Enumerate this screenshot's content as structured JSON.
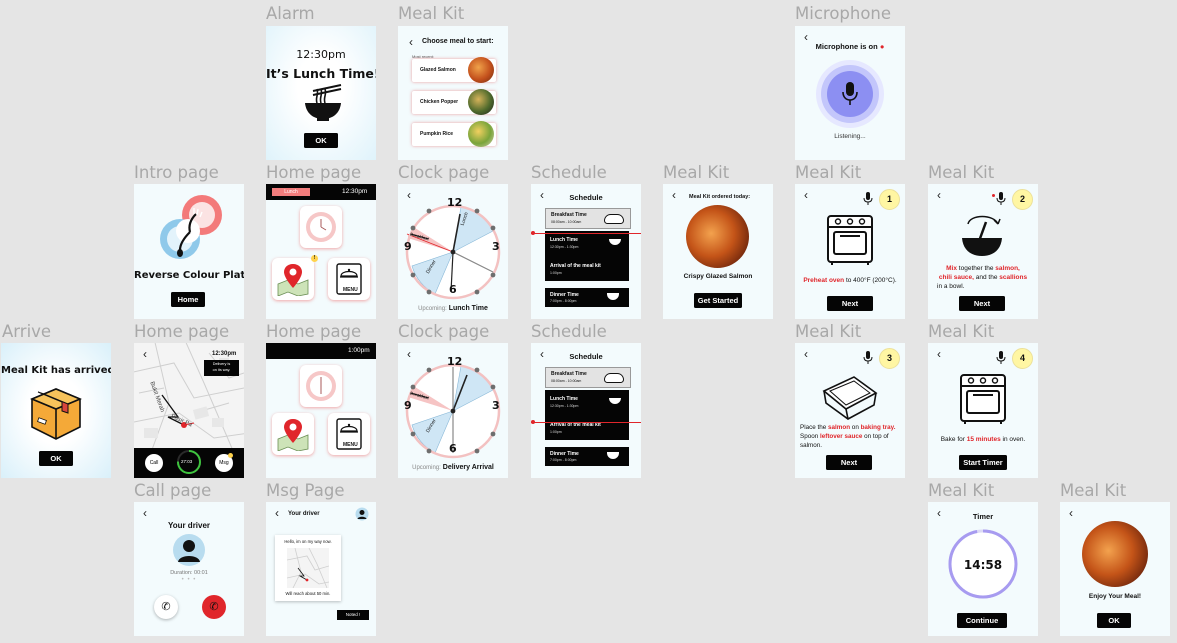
{
  "labels": {
    "alarm": "Alarm",
    "mealkit": "Meal Kit",
    "microphone": "Microphone",
    "intro": "Intro page",
    "home": "Home page",
    "clock": "Clock page",
    "schedule": "Schedule",
    "arrive": "Arrive",
    "call": "Call page",
    "msg": "Msg Page"
  },
  "alarm": {
    "time": "12:30pm",
    "title": "It’s Lunch Time!",
    "ok": "OK"
  },
  "choose": {
    "title": "Choose meal to start:",
    "recent": "Most recent:",
    "meals": [
      "Glazed Salmon",
      "Chicken Popper",
      "Pumpkin Rice"
    ]
  },
  "mic": {
    "title": "Microphone is on",
    "status": "Listening..."
  },
  "intro": {
    "title": "Reverse Colour Plate",
    "button": "Home"
  },
  "home1": {
    "badge": "Lunch",
    "time": "12:30pm",
    "menu": "MENU"
  },
  "home2": {
    "time": "1:00pm",
    "menu": "MENU"
  },
  "clock": {
    "numbers": [
      "12",
      "3",
      "6",
      "9"
    ],
    "labels": [
      "Lunch",
      "Breakfast",
      "Dinner"
    ],
    "upcoming1_prefix": "Upcoming:",
    "upcoming1": "Lunch Time",
    "upcoming2_prefix": "Upcoming:",
    "upcoming2": "Delivery Arrival"
  },
  "schedule": {
    "title": "Schedule",
    "breakfast": "Breakfast Time",
    "breakfast_time": "08:00am - 10:00am",
    "lunch": "Lunch Time",
    "lunch_time": "12:30pm - 1:30pm",
    "arrival": "Arrival of the meal kit",
    "arrival_time": "1:00pm",
    "dinner": "Dinner Time",
    "dinner_time": "7:00pm - 8:00pm"
  },
  "ordered": {
    "title": "Meal Kit ordered today:",
    "name": "Crispy Glazed Salmon",
    "button": "Get Started"
  },
  "steps": {
    "next": "Next",
    "s1_num": "1",
    "s1_a": "Preheat oven",
    "s1_b": " to 400°F (200°C).",
    "s2_num": "2",
    "s2_l1a": "Mix",
    "s2_l1b": " together the ",
    "s2_l1c": "salmon,",
    "s2_l2a": "chili sauce,",
    "s2_l2b": " and the ",
    "s2_l2c": "scallions",
    "s2_l3": "in a bowl.",
    "s3_num": "3",
    "s3_l1a": "Place the ",
    "s3_l1b": "salmon",
    "s3_l1c": " on ",
    "s3_l1d": "baking tray.",
    "s3_l2a": "Spoon ",
    "s3_l2b": "leftover sauce",
    "s3_l2c": " on top of",
    "s3_l3": "salmon.",
    "s4_num": "4",
    "s4_a": "Bake for ",
    "s4_b": "15 minutes",
    "s4_c": " in oven.",
    "s4_button": "Start Timer"
  },
  "arrive": {
    "title": "Meal Kit has arrived!",
    "ok": "OK"
  },
  "map": {
    "time": "12:30pm",
    "note_l1": "Delivery is",
    "note_l2": "on its way.",
    "street1": "Bukit Merah",
    "street2": "Pasir Pa",
    "call": "Call",
    "eta": "27:03",
    "msg": "Msg"
  },
  "call": {
    "title": "Your driver",
    "duration": "Duration: 00:01"
  },
  "msg": {
    "title": "Your driver",
    "hello": "Hello, im on my way now.",
    "reach": "Will reach about 50 min.",
    "reply": "Noted !"
  },
  "timer": {
    "title": "Timer",
    "time": "14:58",
    "button": "Continue",
    "progress": 0.97
  },
  "enjoy": {
    "title": "Enjoy Your Meal!",
    "ok": "OK"
  }
}
